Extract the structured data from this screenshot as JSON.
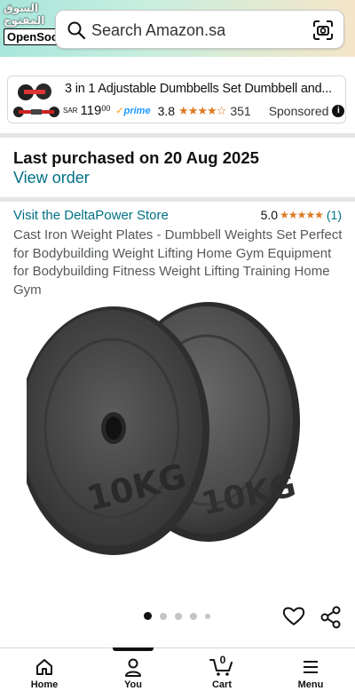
{
  "watermark": {
    "arabic": "السوق المفتوح",
    "brand": "OpenSooq"
  },
  "header": {
    "search_placeholder": "Search Amazon.sa",
    "search_icon": "search-icon",
    "camera_icon": "camera-lens-icon"
  },
  "sponsored_ad": {
    "title": "3 in 1 Adjustable Dumbbells Set Dumbbell and...",
    "currency": "SAR",
    "price_whole": "119",
    "price_fraction": "00",
    "prime_label": "prime",
    "rating": "3.8",
    "stars_display": "★★★★☆",
    "review_count": "351",
    "sponsored_label": "Sponsored",
    "info_icon": "i"
  },
  "purchase": {
    "last_purchased": "Last purchased on 20 Aug 2025",
    "view_order": "View order"
  },
  "product": {
    "store_link": "Visit the DeltaPower Store",
    "rating": "5.0",
    "stars_display": "★★★★★",
    "review_count": "(1)",
    "title": "Cast Iron Weight Plates - Dumbbell Weights Set Perfect for Bodybuilding Weight Lifting Home Gym Equipment for Bodybuilding Fitness Weight Lifting Training Home Gym",
    "plate_marking": "10KG",
    "image_count": 5,
    "active_image_index": 0
  },
  "bottom_nav": {
    "items": [
      {
        "label": "Home",
        "icon": "home-icon"
      },
      {
        "label": "You",
        "icon": "user-icon"
      },
      {
        "label": "Cart",
        "icon": "cart-icon",
        "count": "0"
      },
      {
        "label": "Menu",
        "icon": "menu-icon"
      }
    ],
    "active_index": 1
  },
  "colors": {
    "link": "#007185",
    "star": "#de7921",
    "prime": "#1a98ff"
  }
}
